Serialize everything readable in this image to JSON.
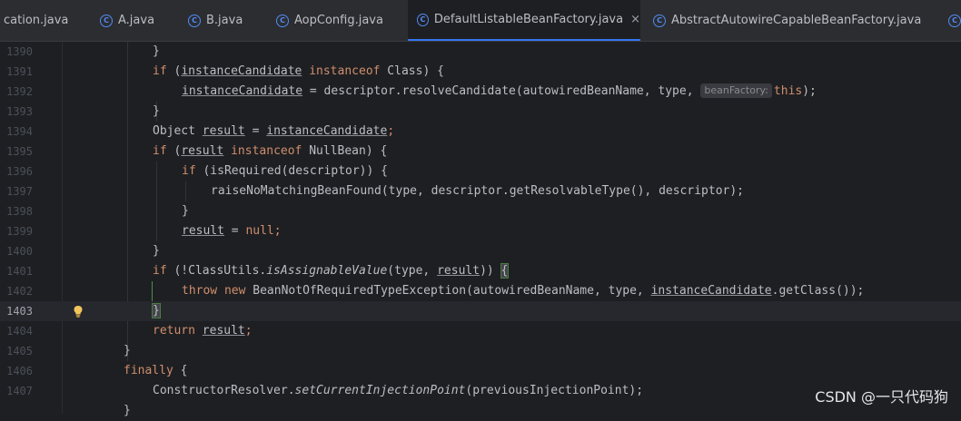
{
  "tabs": [
    {
      "label": "cation.java",
      "icon": "none"
    },
    {
      "label": "A.java",
      "icon": "class-icon"
    },
    {
      "label": "B.java",
      "icon": "class-icon"
    },
    {
      "label": "AopConfig.java",
      "icon": "class-icon"
    },
    {
      "label": "DefaultListableBeanFactory.java",
      "icon": "class-icon",
      "active": true,
      "close": "×"
    },
    {
      "label": "AbstractAutowireCapableBeanFactory.java",
      "icon": "class-icon"
    }
  ],
  "editor": {
    "current_line": "1403",
    "lines": [
      {
        "number": "1390"
      },
      {
        "number": "1391"
      },
      {
        "number": "1392"
      },
      {
        "number": "1393"
      },
      {
        "number": "1394"
      },
      {
        "number": "1395"
      },
      {
        "number": "1396"
      },
      {
        "number": "1397"
      },
      {
        "number": "1398"
      },
      {
        "number": "1399"
      },
      {
        "number": "1400"
      },
      {
        "number": "1401"
      },
      {
        "number": "1402"
      },
      {
        "number": "1403"
      },
      {
        "number": "1404"
      },
      {
        "number": "1405"
      },
      {
        "number": "1406"
      },
      {
        "number": "1407"
      }
    ],
    "t": {
      "l1390": {
        "a": "}"
      },
      "l1391": {
        "a": "if",
        "b": " (",
        "c": "instanceCandidate",
        "d": " ",
        "e": "instanceof",
        "f": " Class) {"
      },
      "l1392": {
        "a": "instanceCandidate",
        "b": " = descriptor.resolveCandidate(autowiredBeanName, type, ",
        "hint": "beanFactory:",
        "c": "this",
        "d": ");"
      },
      "l1393": {
        "a": "}"
      },
      "l1394": {
        "a": "Object ",
        "b": "result",
        "c": " = ",
        "d": "instanceCandidate",
        "e": ";"
      },
      "l1395": {
        "a": "if",
        "b": " (",
        "c": "result",
        "d": " ",
        "e": "instanceof",
        "f": " NullBean) {"
      },
      "l1396": {
        "a": "if",
        "b": " (isRequired(descriptor)) {"
      },
      "l1397": {
        "a": "raiseNoMatchingBeanFound(type, descriptor.getResolvableType(), descriptor);"
      },
      "l1398": {
        "a": "}"
      },
      "l1399": {
        "a": "result",
        "b": " = ",
        "c": "null",
        "d": ";"
      },
      "l1400": {
        "a": "}"
      },
      "l1401": {
        "a": "if",
        "b": " (!ClassUtils.",
        "c": "isAssignableValue",
        "d": "(type, ",
        "e": "result",
        "f": ")) ",
        "g": "{"
      },
      "l1402": {
        "a": "throw",
        "b": " ",
        "c": "new",
        "d": " BeanNotOfRequiredTypeException(autowiredBeanName, type, ",
        "e": "instanceCandidate",
        "f": ".getClass());"
      },
      "l1403": {
        "a": "}"
      },
      "l1404": {
        "a": "return",
        "b": " ",
        "c": "result",
        "d": ";"
      },
      "l1405": {
        "a": "}"
      },
      "l1406": {
        "a": "finally",
        "b": " {"
      },
      "l1407": {
        "a": "ConstructorResolver.",
        "b": "setCurrentInjectionPoint",
        "c": "(previousInjectionPoint);"
      }
    }
  },
  "watermark": "CSDN @一只代码狗",
  "colors": {
    "background": "#1e1f22",
    "keyword": "#cf8e6d",
    "text": "#bcbec4",
    "accent": "#3574f0",
    "line_number": "#4b5059"
  }
}
